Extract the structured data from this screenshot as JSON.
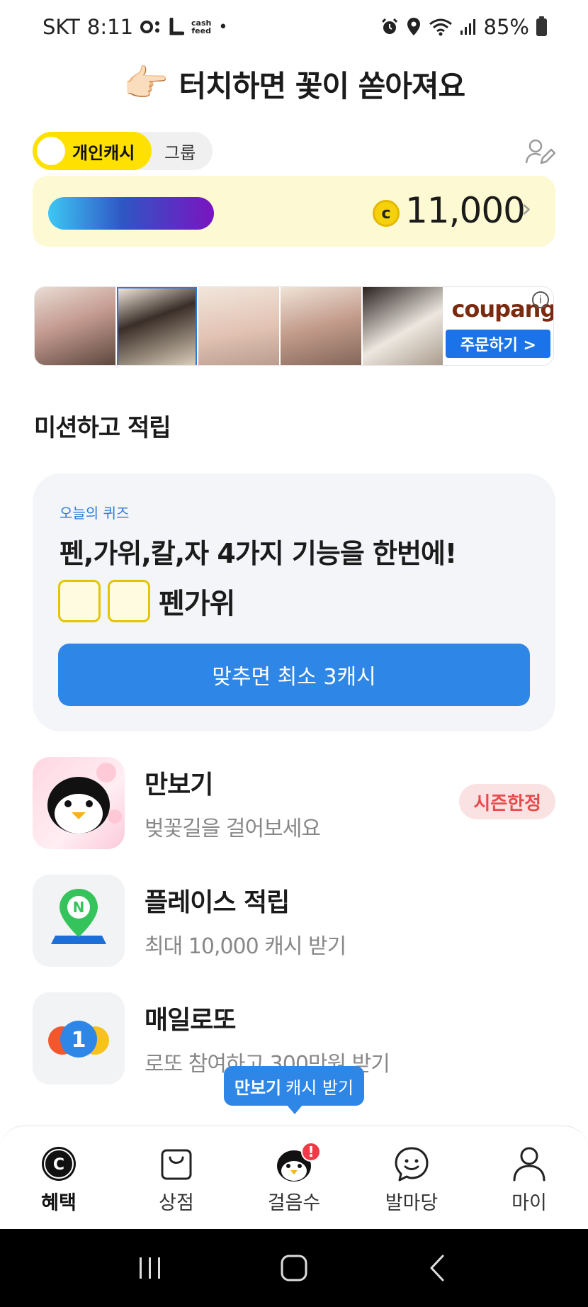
{
  "status_bar": {
    "carrier": "SKT",
    "time": "8:11",
    "app_icons": [
      "o-icon",
      "l-icon",
      "cashfeed-icon"
    ],
    "cashfeed_line1": "cash",
    "cashfeed_line2": "feed",
    "dot": "•",
    "battery": "85%"
  },
  "header": {
    "hand_emoji": "👉🏻",
    "title": "터치하면 꽃이 쏟아져요"
  },
  "toggle": {
    "active": "개인캐시",
    "inactive": "그룹"
  },
  "cash": {
    "coin": "c",
    "value": "11,000",
    "chevron": "›",
    "bar_gradient": [
      "#3dc7f4",
      "#2f56c4",
      "#7a14c0"
    ]
  },
  "ad": {
    "brand": "coupang",
    "info": "i",
    "button": "주문하기 >"
  },
  "missions_section": {
    "title": "미션하고 적립"
  },
  "quiz": {
    "label": "오늘의 퀴즈",
    "question": "펜,가위,칼,자 4가지 기능을 한번에!",
    "hint": "펜가위",
    "button": "맞추면 최소 3캐시"
  },
  "missions": [
    {
      "title": "만보기",
      "subtitle": "벚꽃길을 걸어보세요",
      "badge": "시즌한정",
      "icon": "penguin-icon"
    },
    {
      "title": "플레이스 적립",
      "subtitle": "최대 10,000 캐시 받기",
      "icon": "naver-place-icon"
    },
    {
      "title": "매일로또",
      "subtitle": "로또 참여하고 300만원 받기",
      "icon": "lotto-icon"
    }
  ],
  "tooltip": {
    "bold": "만보기",
    "text": "캐시 받기"
  },
  "bottom_nav": [
    {
      "label": "혜택",
      "icon": "cash-coin-icon",
      "active": true
    },
    {
      "label": "상점",
      "icon": "shopping-bag-icon",
      "active": false
    },
    {
      "label": "걸음수",
      "icon": "penguin-icon",
      "active": false,
      "alert": "!"
    },
    {
      "label": "발마당",
      "icon": "chat-smile-icon",
      "active": false
    },
    {
      "label": "마이",
      "icon": "person-icon",
      "active": false
    }
  ],
  "colors": {
    "accent_yellow": "#ffe100",
    "accent_blue": "#2e86e6",
    "badge_red": "#e74c4c",
    "card_yellow": "#fdf9d2"
  }
}
